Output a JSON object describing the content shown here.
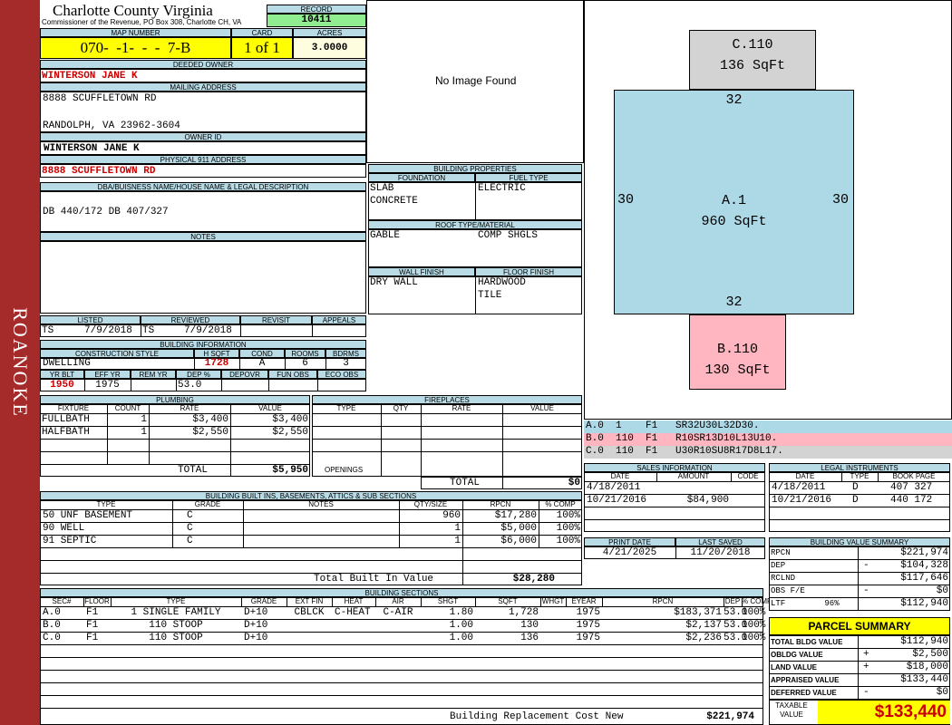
{
  "sidebar": {
    "county": "ROANOKE"
  },
  "header": {
    "title": "Charlotte County Virginia",
    "subtitle": "Commissioner of the Revenue, PO Box 308, Charlotte CH, VA",
    "record_label": "RECORD",
    "record": "10411"
  },
  "map": {
    "map_label": "MAP NUMBER",
    "map_number": "070-  -1-  -  -  7-B",
    "card_label": "CARD",
    "card": "1 of 1",
    "acres_label": "ACRES",
    "acres": "3.0000"
  },
  "owner": {
    "deeded_label": "DEEDED OWNER",
    "deeded_owner": "WINTERSON JANE K",
    "mailing_label": "MAILING ADDRESS",
    "address1": "8888 SCUFFLETOWN RD",
    "address2": "RANDOLPH, VA 23962-3604",
    "owner_id_label": "OWNER ID",
    "owner_id": "WINTERSON JANE K",
    "physical_label": "PHYSICAL 911 ADDRESS",
    "physical": "8888 SCUFFLETOWN RD"
  },
  "legal": {
    "label": "DBA/BUISNESS NAME/HOUSE NAME & LEGAL DESCRIPTION",
    "text": "DB 440/172 DB 407/327"
  },
  "notes": {
    "label": "NOTES"
  },
  "image": {
    "text": "No Image Found"
  },
  "props": {
    "title": "BUILDING PROPERTIES",
    "foundation_label": "FOUNDATION",
    "fuel_label": "FUEL TYPE",
    "foundation1": "SLAB",
    "foundation2": "CONCRETE",
    "fuel": "ELECTRIC",
    "roof_label": "ROOF TYPE/MATERIAL",
    "roof_type": "GABLE",
    "roof_material": "COMP SHGLS",
    "wall_label": "WALL FINISH",
    "floor_label": "FLOOR FINISH",
    "wall": "DRY WALL",
    "floor1": "HARDWOOD",
    "floor2": "TILE"
  },
  "dates": {
    "listed_label": "LISTED",
    "reviewed_label": "REVIEWED",
    "revisit_label": "REVISIT",
    "appeals_label": "APPEALS",
    "listed_by": "TS",
    "listed_date": "7/9/2018",
    "reviewed_by": "TS",
    "reviewed_date": "7/9/2018"
  },
  "bldg_info": {
    "title": "BUILDING INFORMATION",
    "style_label": "CONSTRUCTION STYLE",
    "hsqft_label": "H SQFT",
    "cond_label": "COND",
    "rooms_label": "ROOMS",
    "bdrms_label": "BDRMS",
    "style": "DWELLING",
    "hsqft": "1728",
    "cond": "A",
    "rooms": "6",
    "bdrms": "3",
    "yrblt_label": "YR BLT",
    "effyr_label": "EFF YR",
    "remyr_label": "REM YR",
    "dep_label": "DEP %",
    "depovr_label": "DEPOVR",
    "funobs_label": "FUN OBS",
    "ecoobs_label": "ECO OBS",
    "yrblt": "1950",
    "effyr": "1975",
    "dep": "53.0"
  },
  "plumbing": {
    "title": "PLUMBING",
    "headers": [
      "FIXTURE",
      "COUNT",
      "RATE",
      "VALUE"
    ],
    "rows": [
      [
        "FULLBATH",
        "1",
        "$3,400",
        "$3,400"
      ],
      [
        "HALFBATH",
        "1",
        "$2,550",
        "$2,550"
      ]
    ],
    "total_label": "TOTAL",
    "total": "$5,950"
  },
  "fireplaces": {
    "title": "FIREPLACES",
    "headers": [
      "TYPE",
      "QTY",
      "RATE",
      "VALUE"
    ],
    "openings_label": "OPENINGS",
    "total_label": "TOTAL",
    "total": "$0"
  },
  "builtins": {
    "title": "BUILDING BUILT INS, BASEMENTS, ATTICS & SUB SECTIONS",
    "headers": [
      "TYPE",
      "GRADE",
      "NOTES",
      "QTY/SIZE",
      "RPCN",
      "% COMP"
    ],
    "rows": [
      [
        "50 UNF BASEMENT",
        "C",
        "",
        "960",
        "$17,280",
        "100%"
      ],
      [
        "90 WELL",
        "C",
        "",
        "1",
        "$5,000",
        "100%"
      ],
      [
        "91 SEPTIC",
        "C",
        "",
        "1",
        "$6,000",
        "100%"
      ]
    ],
    "total_label": "Total Built In Value",
    "total": "$28,280"
  },
  "sections": {
    "title": "BUILDING SECTIONS",
    "headers": [
      "SEC#",
      "FLOOR",
      "TYPE",
      "GRADE",
      "EXT FIN",
      "HEAT",
      "AIR",
      "SHGT",
      "SQFT",
      "WHGT",
      "EYEAR",
      "RPCN",
      "DEP",
      "% COMP"
    ],
    "rows": [
      [
        "A.0",
        "F1",
        "1 SINGLE FAMILY",
        "D+10",
        "CBLCK",
        "C-HEAT",
        "C-AIR",
        "1.80",
        "1,728",
        "",
        "1975",
        "$183,371",
        "53.0",
        "100%"
      ],
      [
        "B.0",
        "F1",
        "110 STOOP",
        "D+10",
        "",
        "",
        "",
        "1.00",
        "130",
        "",
        "1975",
        "$2,137",
        "53.0",
        "100%"
      ],
      [
        "C.0",
        "F1",
        "110 STOOP",
        "D+10",
        "",
        "",
        "",
        "1.00",
        "136",
        "",
        "1975",
        "$2,236",
        "53.0",
        "100%"
      ]
    ],
    "rcn_label": "Building Replacement Cost New",
    "rcn": "$221,974"
  },
  "sketch": {
    "c_label": "C.110",
    "c_area": "136 SqFt",
    "a_label": "A.1",
    "a_area": "960 SqFt",
    "b_label": "B.110",
    "b_area": "130 SqFt",
    "top_dim": "32",
    "bottom_dim": "32",
    "left_dim": "30",
    "right_dim": "30",
    "a_color": "#add8e6",
    "b_color": "#ffb6c1",
    "c_color": "#d3d3d3"
  },
  "vectors": [
    {
      "text": "A.0  1    F1   SR32U30L32D30.",
      "color": "#add8e6"
    },
    {
      "text": "B.0  110  F1   R10SR13D10L13U10.",
      "color": "#ffb6c1"
    },
    {
      "text": "C.0  110  F1   U30R10SU8R17D8L17.",
      "color": "#d3d3d3"
    }
  ],
  "sales": {
    "title": "SALES INFORMATION",
    "headers": [
      "DATE",
      "AMOUNT",
      "CODE"
    ],
    "rows": [
      [
        "4/18/2011",
        "",
        ""
      ],
      [
        "10/21/2016",
        "$84,900",
        ""
      ]
    ]
  },
  "legal_inst": {
    "title": "LEGAL INSTRUMENTS",
    "headers": [
      "DATE",
      "TYPE",
      "BOOK PAGE"
    ],
    "rows": [
      [
        "4/18/2011",
        "D",
        "407 327"
      ],
      [
        "10/21/2016",
        "D",
        "440 172"
      ]
    ]
  },
  "print": {
    "print_label": "PRINT DATE",
    "saved_label": "LAST SAVED",
    "print_date": "4/21/2025",
    "last_saved": "11/20/2018"
  },
  "value_summary": {
    "title": "BUILDING VALUE SUMMARY",
    "rows": [
      [
        "RPCN",
        "",
        "$221,974"
      ],
      [
        "DEP",
        "-",
        "$104,328"
      ],
      [
        "RCLND",
        "",
        "$117,646"
      ],
      [
        "OBS F/E",
        "-",
        "$0"
      ],
      [
        "LTF        96%",
        "",
        "$112,940"
      ]
    ]
  },
  "parcel": {
    "title": "PARCEL SUMMARY",
    "rows": [
      [
        "TOTAL BLDG VALUE",
        "",
        "$112,940"
      ],
      [
        "OBLDG VALUE",
        "+",
        "$2,500"
      ],
      [
        "LAND VALUE",
        "+",
        "$18,000"
      ],
      [
        "APPRAISED VALUE",
        "",
        "$133,440"
      ],
      [
        "DEFERRED VALUE",
        "-",
        "$0"
      ]
    ],
    "taxable_label1": "TAXABLE",
    "taxable_label2": "VALUE",
    "taxable": "$133,440"
  }
}
